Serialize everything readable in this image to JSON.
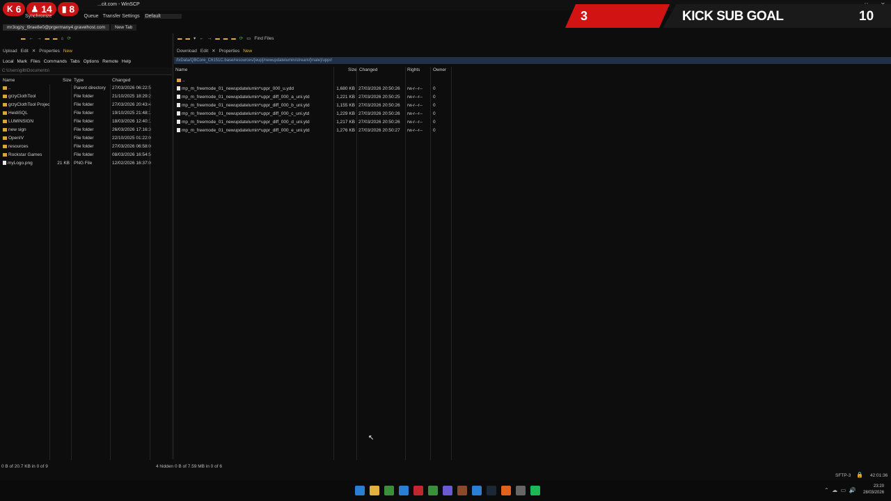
{
  "window": {
    "title": "...cit.com - WinSCP",
    "controls": [
      "–",
      "□",
      "✕"
    ]
  },
  "overlay": {
    "kick_followers": "6",
    "followers": "14",
    "viewers": "8",
    "goal_current": "3",
    "goal_label": "KICK SUB GOAL",
    "goal_target": "10"
  },
  "toolbar": {
    "synchronize": "Synchronize",
    "queue": "Queue",
    "transfer_settings": "Transfer Settings",
    "transfer_value": "Default"
  },
  "tabs": [
    {
      "label": "mr3ogzy_l9rae8e0@prgermany4.gravelhost.com"
    },
    {
      "label": "New Tab"
    }
  ],
  "left_pane": {
    "toolbar": [
      "Upload",
      "Edit",
      "Properties",
      "New"
    ],
    "menu": [
      "Local",
      "Mark",
      "Files",
      "Commands",
      "Tabs",
      "Options",
      "Remote",
      "Help"
    ],
    "path": "C:\\Users\\gilb\\Documents\\",
    "columns": [
      "Name",
      "Size",
      "Type",
      "Changed"
    ],
    "rows": [
      {
        "name": "..",
        "size": "",
        "type": "Parent directory",
        "changed": "27/03/2026 06:22:57",
        "icon": "folder"
      },
      {
        "name": "grzyClothTool",
        "size": "",
        "type": "File folder",
        "changed": "21/10/2025 18:29:21",
        "icon": "folder"
      },
      {
        "name": "grzyClothTool Projects",
        "size": "",
        "type": "File folder",
        "changed": "27/03/2026 20:43:42",
        "icon": "folder"
      },
      {
        "name": "HeidiSQL",
        "size": "",
        "type": "File folder",
        "changed": "19/10/2025 21:48:15",
        "icon": "folder"
      },
      {
        "name": "LUMINSIGN",
        "size": "",
        "type": "File folder",
        "changed": "18/03/2026 12:40:15",
        "icon": "folder"
      },
      {
        "name": "new sign",
        "size": "",
        "type": "File folder",
        "changed": "26/03/2026 17:16:38",
        "icon": "folder"
      },
      {
        "name": "OpenIV",
        "size": "",
        "type": "File folder",
        "changed": "22/10/2025 01:22:07",
        "icon": "folder"
      },
      {
        "name": "resources",
        "size": "",
        "type": "File folder",
        "changed": "27/03/2026 06:58:00",
        "icon": "folder"
      },
      {
        "name": "Rockstar Games",
        "size": "",
        "type": "File folder",
        "changed": "08/03/2026 16:54:59",
        "icon": "folder"
      },
      {
        "name": "myLogo.png",
        "size": "21 KB",
        "type": "PNG File",
        "changed": "12/02/2026 16:37:00",
        "icon": "file"
      }
    ],
    "status": "0 B of 20.7 KB in 0 of 9",
    "hidden": "4 hidden"
  },
  "right_pane": {
    "toolbar": [
      "Download",
      "Edit",
      "Properties",
      "New"
    ],
    "nav_toolbar": [
      "Find Files"
    ],
    "path": "/txData/QBCore_C6151C.base/resources/[eup]/newupdatelumin/stream/[male]/uppr/",
    "columns": [
      "Name",
      "Size",
      "Changed",
      "Rights",
      "Owner"
    ],
    "rows": [
      {
        "name": "..",
        "size": "",
        "changed": "",
        "rights": "",
        "owner": "",
        "icon": "folder"
      },
      {
        "name": "mp_m_freemode_01_newupdatelumin^uppr_000_u.ydd",
        "size": "1,680 KB",
        "changed": "27/03/2026 20:50:26",
        "rights": "rw-r--r--",
        "owner": "0",
        "icon": "file"
      },
      {
        "name": "mp_m_freemode_01_newupdatelumin^uppr_diff_000_a_uni.ytd",
        "size": "1,221 KB",
        "changed": "27/03/2026 20:50:25",
        "rights": "rw-r--r--",
        "owner": "0",
        "icon": "file"
      },
      {
        "name": "mp_m_freemode_01_newupdatelumin^uppr_diff_000_b_uni.ytd",
        "size": "1,155 KB",
        "changed": "27/03/2026 20:50:26",
        "rights": "rw-r--r--",
        "owner": "0",
        "icon": "file"
      },
      {
        "name": "mp_m_freemode_01_newupdatelumin^uppr_diff_000_c_uni.ytd",
        "size": "1,229 KB",
        "changed": "27/03/2026 20:50:26",
        "rights": "rw-r--r--",
        "owner": "0",
        "icon": "file"
      },
      {
        "name": "mp_m_freemode_01_newupdatelumin^uppr_diff_000_d_uni.ytd",
        "size": "1,217 KB",
        "changed": "27/03/2026 20:50:26",
        "rights": "rw-r--r--",
        "owner": "0",
        "icon": "file"
      },
      {
        "name": "mp_m_freemode_01_newupdatelumin^uppr_diff_000_e_uni.ytd",
        "size": "1,276 KB",
        "changed": "27/03/2026 20:50:27",
        "rights": "rw-r--r--",
        "owner": "0",
        "icon": "file"
      }
    ],
    "status": "0 B of 7.59 MB in 0 of 6"
  },
  "statusbar": {
    "protocol": "SFTP-3",
    "elapsed": "42:01:36"
  },
  "taskbar": {
    "time": "23:20",
    "date": "28/03/2026",
    "apps": [
      "windows-start",
      "file-explorer",
      "chrome",
      "vscode",
      "app-red",
      "app-green",
      "app-purple",
      "app-grid",
      "app-blue",
      "steam",
      "app-orange",
      "app-gray",
      "spotify"
    ]
  },
  "colors": {
    "accent_red": "#d11313",
    "folder": "#d9a43a",
    "path_bar": "#1f3047"
  }
}
